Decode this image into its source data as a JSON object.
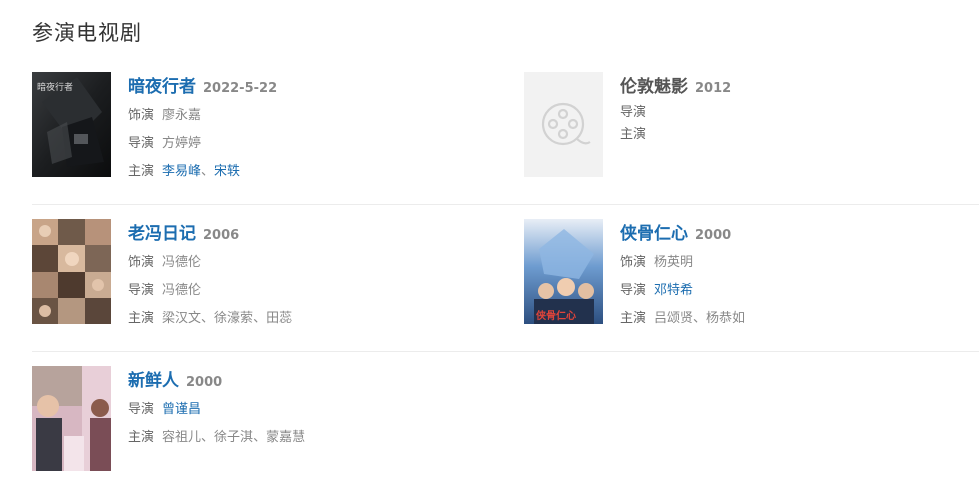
{
  "section": {
    "title": "参演电视剧"
  },
  "works": [
    {
      "title": "暗夜行者",
      "year": "2022-5-22",
      "role_label": "饰演",
      "role": "廖永嘉",
      "director_label": "导演",
      "director": "方婷婷",
      "cast_label": "主演",
      "cast": [
        "李易峰",
        "宋轶"
      ],
      "poster_caption": "暗夜行者"
    },
    {
      "title": "伦敦魅影",
      "year": "2012",
      "director_label": "导演",
      "cast_label": "主演"
    },
    {
      "title": "老冯日记",
      "year": "2006",
      "role_label": "饰演",
      "role": "冯德伦",
      "director_label": "导演",
      "director": "冯德伦",
      "cast_label": "主演",
      "cast": [
        "梁汉文",
        "徐濠萦",
        "田蕊"
      ]
    },
    {
      "title": "侠骨仁心",
      "year": "2000",
      "role_label": "饰演",
      "role": "杨英明",
      "director_label": "导演",
      "director": "邓特希",
      "cast_label": "主演",
      "cast": [
        "吕颂贤",
        "杨恭如"
      ],
      "poster_caption": "侠骨仁心"
    },
    {
      "title": "新鲜人",
      "year": "2000",
      "director_label": "导演",
      "director": "曾谨昌",
      "cast_label": "主演",
      "cast": [
        "容祖儿",
        "徐子淇",
        "蒙嘉慧"
      ]
    }
  ],
  "separator": "、",
  "colors": {
    "link": "#1c6db0",
    "divider": "#ececec",
    "muted": "#888888"
  }
}
